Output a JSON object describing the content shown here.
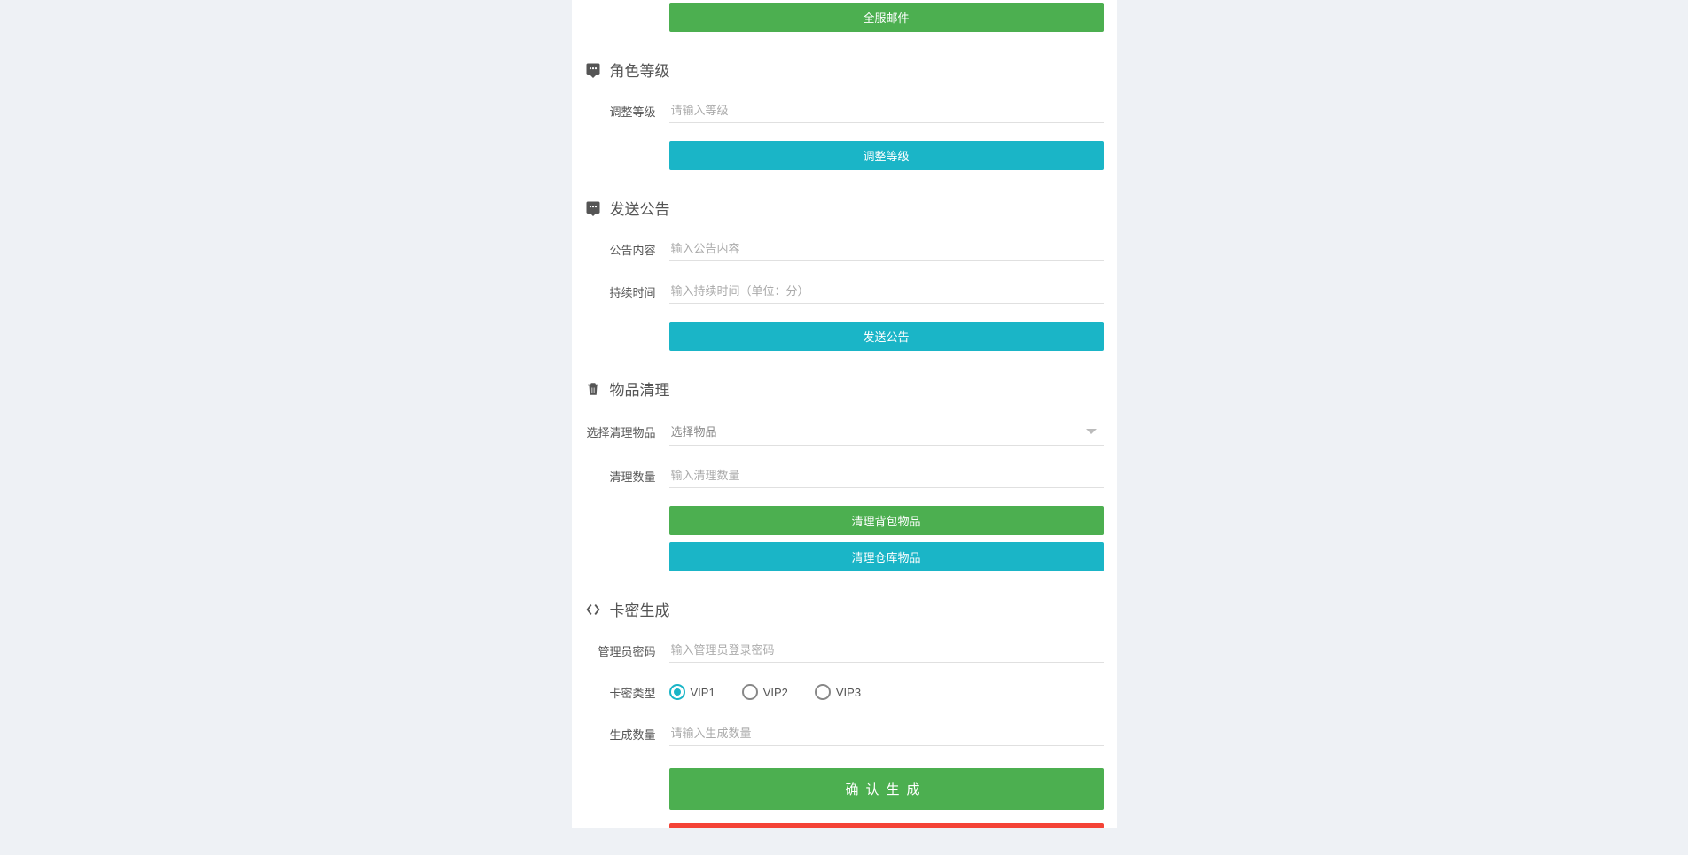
{
  "top_button": "全服邮件",
  "sections": {
    "level": {
      "title": "角色等级",
      "field_label": "调整等级",
      "field_placeholder": "请输入等级",
      "button": "调整等级"
    },
    "announce": {
      "title": "发送公告",
      "content_label": "公告内容",
      "content_placeholder": "输入公告内容",
      "duration_label": "持续时间",
      "duration_placeholder": "输入持续时间（单位：分）",
      "button": "发送公告"
    },
    "cleanup": {
      "title": "物品清理",
      "select_label": "选择清理物品",
      "select_placeholder": "选择物品",
      "qty_label": "清理数量",
      "qty_placeholder": "输入清理数量",
      "btn_bag": "清理背包物品",
      "btn_warehouse": "清理仓库物品"
    },
    "cardkey": {
      "title": "卡密生成",
      "pwd_label": "管理员密码",
      "pwd_placeholder": "输入管理员登录密码",
      "type_label": "卡密类型",
      "types": [
        "VIP1",
        "VIP2",
        "VIP3"
      ],
      "selected_type": "VIP1",
      "qty_label": "生成数量",
      "qty_placeholder": "请输入生成数量",
      "btn_confirm": "确认生成"
    }
  }
}
